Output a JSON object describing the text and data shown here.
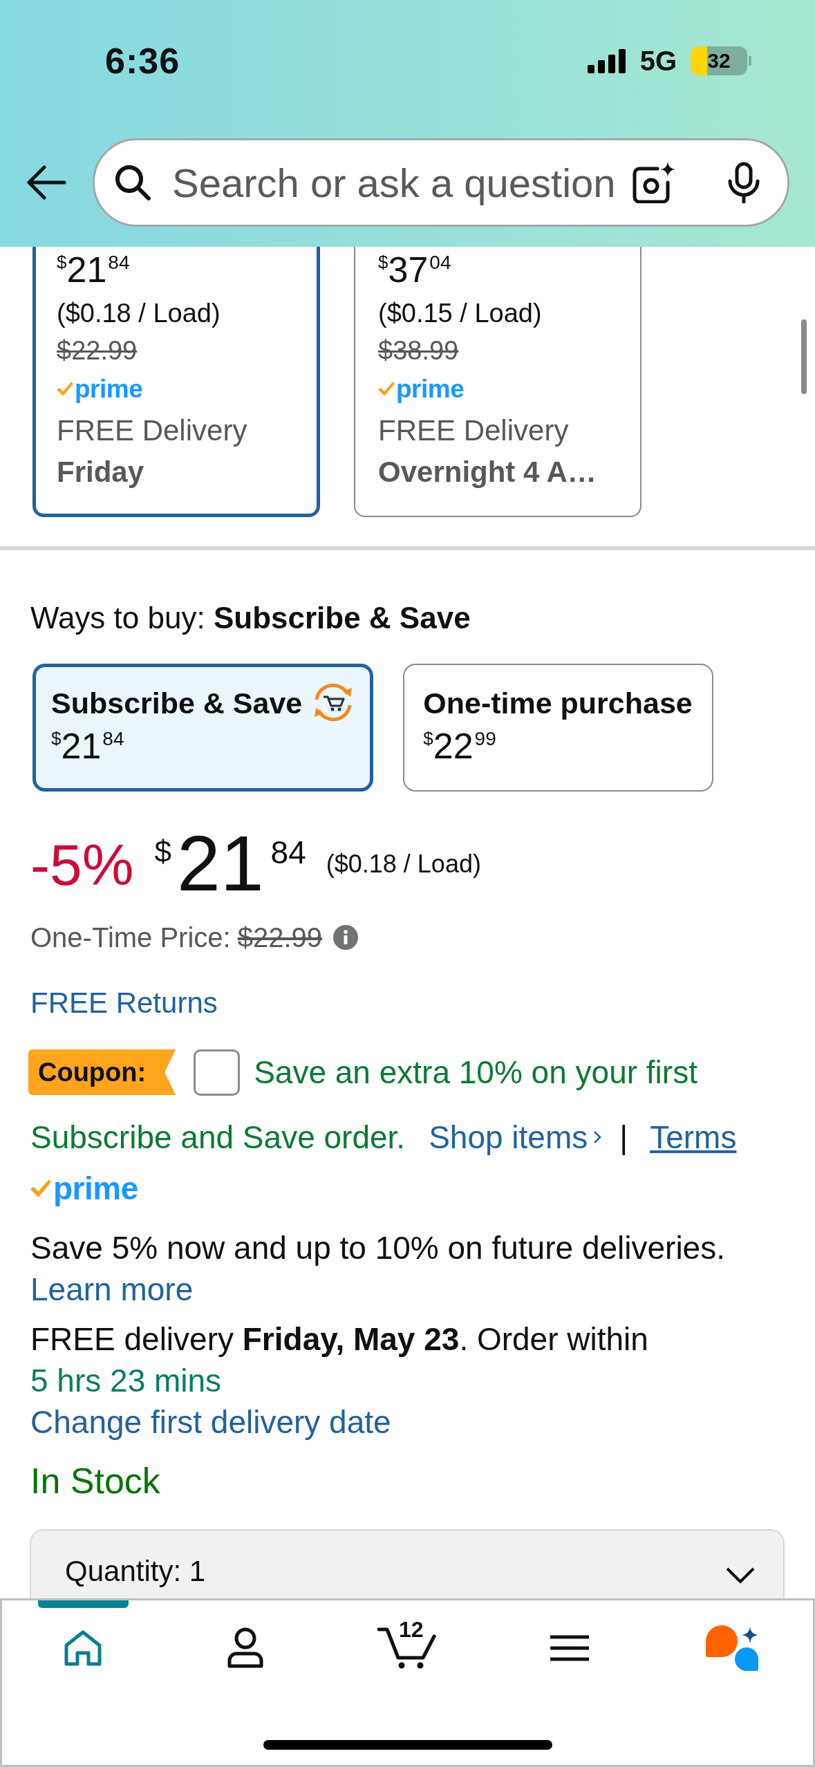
{
  "status_bar": {
    "time": "6:36",
    "network": "5G",
    "battery": "32"
  },
  "search": {
    "placeholder": "Search or ask a question"
  },
  "offers": [
    {
      "selected": true,
      "price": {
        "currency": "$",
        "whole": "21",
        "fraction": "84"
      },
      "unit_price": "($0.18 / Load)",
      "list_price": "$22.99",
      "prime": "prime",
      "delivery": "FREE Delivery",
      "delivery_day": "Friday"
    },
    {
      "selected": false,
      "price": {
        "currency": "$",
        "whole": "37",
        "fraction": "04"
      },
      "unit_price": "($0.15 / Load)",
      "list_price": "$38.99",
      "prime": "prime",
      "delivery": "FREE Delivery",
      "delivery_day": "Overnight 4 A…"
    }
  ],
  "ways_to_buy": {
    "heading": "Ways to buy: **Subscribe & Save**",
    "options": [
      {
        "kind": "subscribe",
        "title": "Subscribe & Save",
        "price": {
          "currency": "$",
          "whole": "21",
          "fraction": "84"
        },
        "selected": true
      },
      {
        "kind": "one_time",
        "title": "One-time purchase",
        "price": {
          "currency": "$",
          "whole": "22",
          "fraction": "99"
        },
        "selected": false
      }
    ]
  },
  "price": {
    "discount": "-5%",
    "currency": "$",
    "whole": "21",
    "fraction": "84",
    "unit_price": "($0.18 / Load)",
    "one_time_label": "One-Time Price:",
    "one_time_price": "$22.99"
  },
  "returns_link": "FREE Returns",
  "coupon": {
    "badge": "Coupon:",
    "checked": false,
    "message_lines": [
      "Save an extra 10% on your first",
      "Subscribe and Save order."
    ],
    "shop_link": "Shop items",
    "separator": "|",
    "terms_link": "Terms"
  },
  "subscription": {
    "prime": "prime",
    "note": "Save 5% now and up to 10% on future deliveries.",
    "learn_more_link": "Learn more"
  },
  "delivery": {
    "text": "FREE delivery **Friday, May 23**. Order within",
    "countdown": "5 hrs 23 mins",
    "change_link": "Change first delivery date"
  },
  "availability": "In Stock",
  "quantity": {
    "label": "Quantity: 1"
  },
  "bottom_nav": {
    "items": [
      {
        "kind": "home",
        "selected": true
      },
      {
        "kind": "account",
        "selected": false
      },
      {
        "kind": "cart",
        "selected": false,
        "count": "12"
      },
      {
        "kind": "menu",
        "selected": false
      },
      {
        "kind": "assistant",
        "selected": false
      }
    ]
  }
}
